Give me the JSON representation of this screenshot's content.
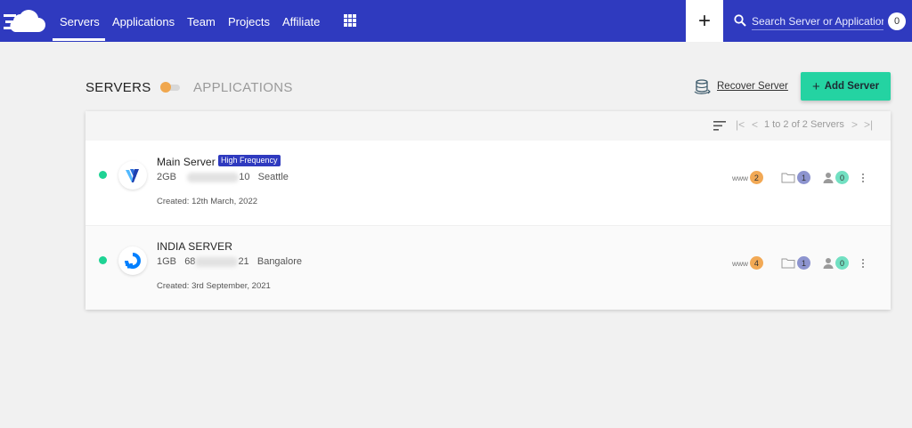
{
  "nav": {
    "items": [
      {
        "label": "Servers",
        "active": true
      },
      {
        "label": "Applications"
      },
      {
        "label": "Team"
      },
      {
        "label": "Projects"
      },
      {
        "label": "Affiliate"
      }
    ],
    "apps_icon": "grid-icon",
    "plus_label": "+",
    "search_placeholder": "Search Server or Application",
    "notification_count": "0"
  },
  "header": {
    "servers_label": "SERVERS",
    "applications_label": "APPLICATIONS",
    "recover_label": "Recover Server",
    "add_server_label": "Add Server",
    "add_server_plus": "+"
  },
  "pagination": {
    "text": "1 to 2 of 2 Servers",
    "first": "|<",
    "prev": "<",
    "next": ">",
    "last": ">|"
  },
  "servers": [
    {
      "name": "Main Server",
      "badge": "High Frequency",
      "size": "2GB",
      "ip_visible_tail": "10",
      "location": "Seattle",
      "created": "Created: 12th March, 2022",
      "www_label": "www",
      "www_count": "2",
      "apps_count": "1",
      "users_count": "0",
      "provider_icon": "vultr-logo-icon"
    },
    {
      "name": "INDIA SERVER",
      "size": "1GB",
      "ip_visible_head": "68",
      "ip_visible_tail": "21",
      "location": "Bangalore",
      "created": "Created: 3rd September, 2021",
      "www_label": "www",
      "www_count": "4",
      "apps_count": "1",
      "users_count": "0",
      "provider_icon": "digitalocean-logo-icon"
    }
  ],
  "colors": {
    "nav_bg": "#2f3abf",
    "accent_green": "#24d3a2",
    "status_green": "#1ed394",
    "www_orange": "#f2a955",
    "apps_purple": "#8d94cf",
    "users_teal": "#72e0c2"
  }
}
